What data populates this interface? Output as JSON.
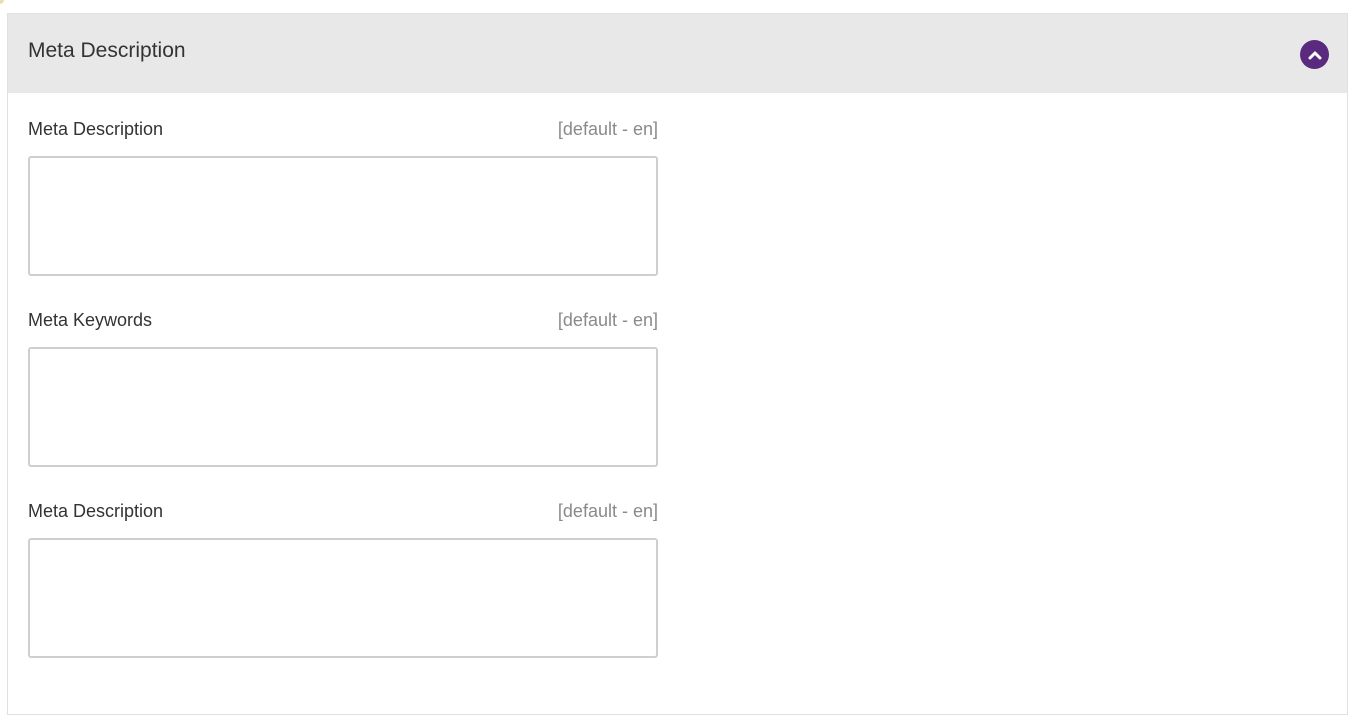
{
  "panel": {
    "title": "Meta Description",
    "collapse_icon": "chevron-up-icon",
    "accent_color": "#5a2a7f",
    "header_background": "#e8e8e8"
  },
  "fields": [
    {
      "label": "Meta Description",
      "scope": "[default - en]",
      "value": "",
      "placeholder": ""
    },
    {
      "label": "Meta Keywords",
      "scope": "[default - en]",
      "value": "",
      "placeholder": ""
    },
    {
      "label": "Meta Description",
      "scope": "[default - en]",
      "value": "",
      "placeholder": ""
    }
  ]
}
